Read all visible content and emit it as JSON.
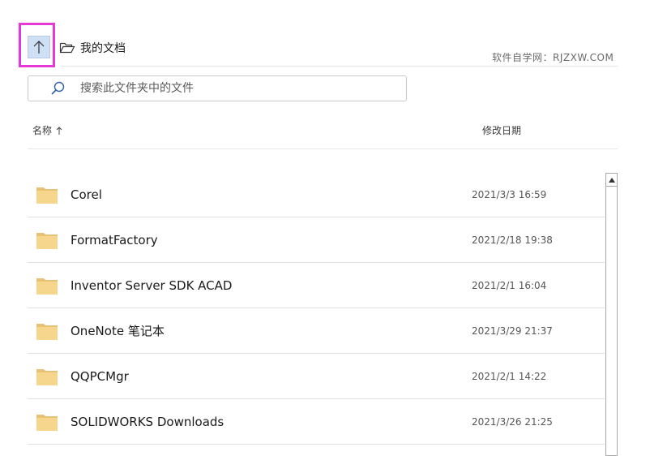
{
  "toolbar": {
    "up_icon": "arrow-up-icon",
    "folder_icon": "open-folder-icon",
    "current_folder": "我的文档",
    "highlight_color": "#e63ad6"
  },
  "watermark": "软件自学网：RJZXW.COM",
  "search": {
    "placeholder": "搜索此文件夹中的文件",
    "value": "",
    "icon": "search-icon"
  },
  "columns": {
    "name": "名称",
    "name_sort_icon": "sort-ascending-icon",
    "modified": "修改日期"
  },
  "files": [
    {
      "name": "Corel",
      "modified": "2021/3/3 16:59",
      "icon": "folder-icon"
    },
    {
      "name": "FormatFactory",
      "modified": "2021/2/18 19:38",
      "icon": "folder-icon"
    },
    {
      "name": "Inventor Server SDK ACAD",
      "modified": "2021/2/1 16:04",
      "icon": "folder-icon"
    },
    {
      "name": "OneNote 笔记本",
      "modified": "2021/3/29 21:37",
      "icon": "folder-icon"
    },
    {
      "name": "QQPCMgr",
      "modified": "2021/2/1 14:22",
      "icon": "folder-icon"
    },
    {
      "name": "SOLIDWORKS Downloads",
      "modified": "2021/3/26 21:25",
      "icon": "folder-icon"
    }
  ]
}
